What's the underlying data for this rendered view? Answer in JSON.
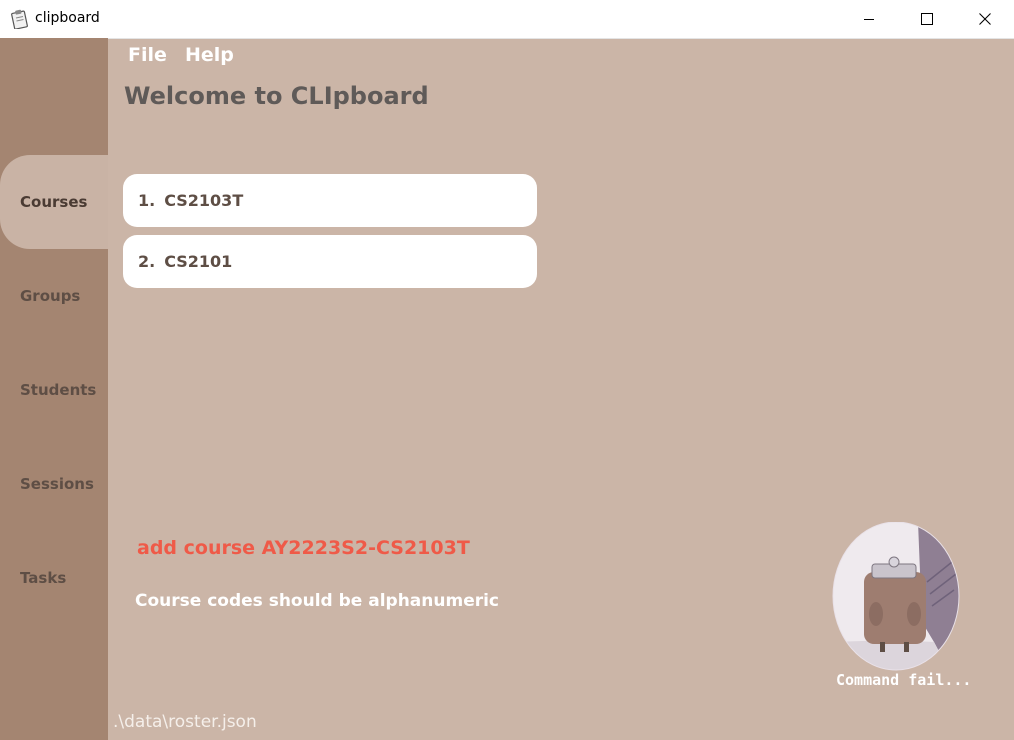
{
  "window": {
    "title": "clipboard",
    "icon": "clipboard-app-icon"
  },
  "menu": {
    "file": "File",
    "help": "Help"
  },
  "header": {
    "welcome": "Welcome to CLIpboard"
  },
  "sidebar": {
    "items": [
      {
        "label": "Courses",
        "active": true
      },
      {
        "label": "Groups",
        "active": false
      },
      {
        "label": "Students",
        "active": false
      },
      {
        "label": "Sessions",
        "active": false
      },
      {
        "label": "Tasks",
        "active": false
      }
    ]
  },
  "courses": [
    {
      "index": "1.",
      "code": "CS2103T"
    },
    {
      "index": "2.",
      "code": "CS2101"
    }
  ],
  "command": {
    "input": "add course AY2223S2-CS2103T",
    "result": "Course codes should be alphanumeric"
  },
  "mascot": {
    "caption": "Command fail..."
  },
  "status": {
    "path": ".\\data\\roster.json"
  },
  "colors": {
    "background": "#cbb5a7",
    "sidebar": "#a48571",
    "error": "#ef5a48",
    "card": "#ffffff"
  }
}
